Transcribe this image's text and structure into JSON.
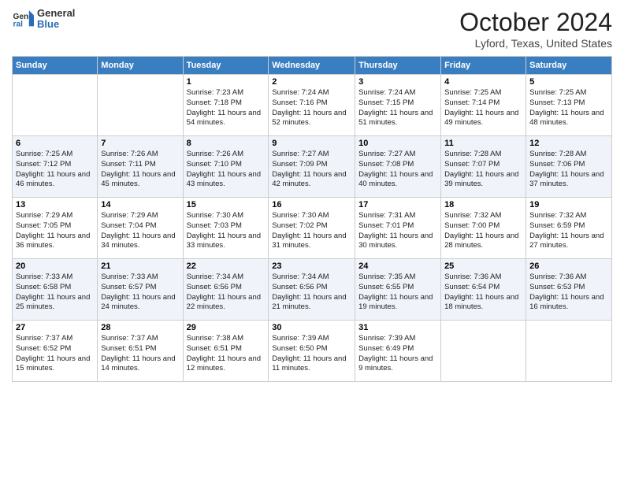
{
  "header": {
    "logo_general": "General",
    "logo_blue": "Blue",
    "month_title": "October 2024",
    "location": "Lyford, Texas, United States"
  },
  "days_of_week": [
    "Sunday",
    "Monday",
    "Tuesday",
    "Wednesday",
    "Thursday",
    "Friday",
    "Saturday"
  ],
  "weeks": [
    [
      {
        "day": "",
        "info": ""
      },
      {
        "day": "",
        "info": ""
      },
      {
        "day": "1",
        "info": "Sunrise: 7:23 AM\nSunset: 7:18 PM\nDaylight: 11 hours and 54 minutes."
      },
      {
        "day": "2",
        "info": "Sunrise: 7:24 AM\nSunset: 7:16 PM\nDaylight: 11 hours and 52 minutes."
      },
      {
        "day": "3",
        "info": "Sunrise: 7:24 AM\nSunset: 7:15 PM\nDaylight: 11 hours and 51 minutes."
      },
      {
        "day": "4",
        "info": "Sunrise: 7:25 AM\nSunset: 7:14 PM\nDaylight: 11 hours and 49 minutes."
      },
      {
        "day": "5",
        "info": "Sunrise: 7:25 AM\nSunset: 7:13 PM\nDaylight: 11 hours and 48 minutes."
      }
    ],
    [
      {
        "day": "6",
        "info": "Sunrise: 7:25 AM\nSunset: 7:12 PM\nDaylight: 11 hours and 46 minutes."
      },
      {
        "day": "7",
        "info": "Sunrise: 7:26 AM\nSunset: 7:11 PM\nDaylight: 11 hours and 45 minutes."
      },
      {
        "day": "8",
        "info": "Sunrise: 7:26 AM\nSunset: 7:10 PM\nDaylight: 11 hours and 43 minutes."
      },
      {
        "day": "9",
        "info": "Sunrise: 7:27 AM\nSunset: 7:09 PM\nDaylight: 11 hours and 42 minutes."
      },
      {
        "day": "10",
        "info": "Sunrise: 7:27 AM\nSunset: 7:08 PM\nDaylight: 11 hours and 40 minutes."
      },
      {
        "day": "11",
        "info": "Sunrise: 7:28 AM\nSunset: 7:07 PM\nDaylight: 11 hours and 39 minutes."
      },
      {
        "day": "12",
        "info": "Sunrise: 7:28 AM\nSunset: 7:06 PM\nDaylight: 11 hours and 37 minutes."
      }
    ],
    [
      {
        "day": "13",
        "info": "Sunrise: 7:29 AM\nSunset: 7:05 PM\nDaylight: 11 hours and 36 minutes."
      },
      {
        "day": "14",
        "info": "Sunrise: 7:29 AM\nSunset: 7:04 PM\nDaylight: 11 hours and 34 minutes."
      },
      {
        "day": "15",
        "info": "Sunrise: 7:30 AM\nSunset: 7:03 PM\nDaylight: 11 hours and 33 minutes."
      },
      {
        "day": "16",
        "info": "Sunrise: 7:30 AM\nSunset: 7:02 PM\nDaylight: 11 hours and 31 minutes."
      },
      {
        "day": "17",
        "info": "Sunrise: 7:31 AM\nSunset: 7:01 PM\nDaylight: 11 hours and 30 minutes."
      },
      {
        "day": "18",
        "info": "Sunrise: 7:32 AM\nSunset: 7:00 PM\nDaylight: 11 hours and 28 minutes."
      },
      {
        "day": "19",
        "info": "Sunrise: 7:32 AM\nSunset: 6:59 PM\nDaylight: 11 hours and 27 minutes."
      }
    ],
    [
      {
        "day": "20",
        "info": "Sunrise: 7:33 AM\nSunset: 6:58 PM\nDaylight: 11 hours and 25 minutes."
      },
      {
        "day": "21",
        "info": "Sunrise: 7:33 AM\nSunset: 6:57 PM\nDaylight: 11 hours and 24 minutes."
      },
      {
        "day": "22",
        "info": "Sunrise: 7:34 AM\nSunset: 6:56 PM\nDaylight: 11 hours and 22 minutes."
      },
      {
        "day": "23",
        "info": "Sunrise: 7:34 AM\nSunset: 6:56 PM\nDaylight: 11 hours and 21 minutes."
      },
      {
        "day": "24",
        "info": "Sunrise: 7:35 AM\nSunset: 6:55 PM\nDaylight: 11 hours and 19 minutes."
      },
      {
        "day": "25",
        "info": "Sunrise: 7:36 AM\nSunset: 6:54 PM\nDaylight: 11 hours and 18 minutes."
      },
      {
        "day": "26",
        "info": "Sunrise: 7:36 AM\nSunset: 6:53 PM\nDaylight: 11 hours and 16 minutes."
      }
    ],
    [
      {
        "day": "27",
        "info": "Sunrise: 7:37 AM\nSunset: 6:52 PM\nDaylight: 11 hours and 15 minutes."
      },
      {
        "day": "28",
        "info": "Sunrise: 7:37 AM\nSunset: 6:51 PM\nDaylight: 11 hours and 14 minutes."
      },
      {
        "day": "29",
        "info": "Sunrise: 7:38 AM\nSunset: 6:51 PM\nDaylight: 11 hours and 12 minutes."
      },
      {
        "day": "30",
        "info": "Sunrise: 7:39 AM\nSunset: 6:50 PM\nDaylight: 11 hours and 11 minutes."
      },
      {
        "day": "31",
        "info": "Sunrise: 7:39 AM\nSunset: 6:49 PM\nDaylight: 11 hours and 9 minutes."
      },
      {
        "day": "",
        "info": ""
      },
      {
        "day": "",
        "info": ""
      }
    ]
  ]
}
